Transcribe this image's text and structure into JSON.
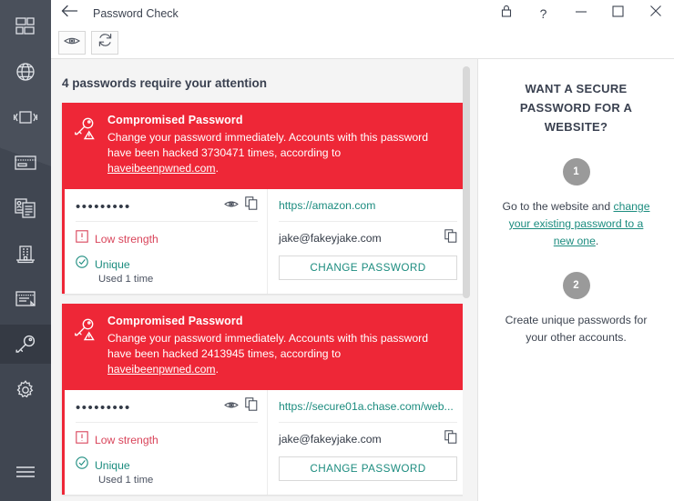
{
  "window": {
    "title": "Password Check",
    "back_icon": "arrow-left-icon",
    "controls": [
      {
        "name": "lock-icon",
        "glyph": "lock"
      },
      {
        "name": "help-icon",
        "glyph": "?"
      },
      {
        "name": "minimize-icon",
        "glyph": "minimize"
      },
      {
        "name": "maximize-icon",
        "glyph": "maximize"
      },
      {
        "name": "close-icon",
        "glyph": "close"
      }
    ]
  },
  "sidebar": {
    "items": [
      {
        "name": "sidebar-item-dashboard",
        "icon": "grid-dashboard-icon",
        "selected": false
      },
      {
        "name": "sidebar-item-websites",
        "icon": "globe-icon",
        "selected": false
      },
      {
        "name": "sidebar-item-devices",
        "icon": "device-icon",
        "selected": false
      },
      {
        "name": "sidebar-item-payments",
        "icon": "credit-card-icon",
        "selected": false
      },
      {
        "name": "sidebar-item-ids",
        "icon": "id-document-icon",
        "selected": false
      },
      {
        "name": "sidebar-item-banking",
        "icon": "bank-building-icon",
        "selected": false
      },
      {
        "name": "sidebar-item-notes",
        "icon": "secure-note-icon",
        "selected": false
      },
      {
        "name": "sidebar-item-password-check",
        "icon": "key-icon",
        "selected": true
      },
      {
        "name": "sidebar-item-settings",
        "icon": "gear-icon",
        "selected": false
      }
    ],
    "menu_icon": "hamburger-menu-icon"
  },
  "toolbar": {
    "buttons": [
      {
        "name": "toggle-visibility-button",
        "icon": "eye-icon"
      },
      {
        "name": "refresh-button",
        "icon": "refresh-icon"
      }
    ]
  },
  "main": {
    "heading": "4 passwords require your attention",
    "cards": [
      {
        "banner_icon": "key-warning-icon",
        "banner_title": "Compromised Password",
        "banner_desc_before": "Change your password immediately. Accounts with this password have been hacked 3730471 times, according to ",
        "banner_link": "haveibeenpwned.com",
        "banner_desc_after": ".",
        "password_masked": "•••••••••",
        "reveal_icon": "eye-icon",
        "copy_password_icon": "copy-icon",
        "strength_label": "Low strength",
        "strength_icon": "alert-box-icon",
        "unique_label": "Unique",
        "unique_icon": "check-circle-icon",
        "usage_label": "Used 1 time",
        "url": "https://amazon.com",
        "username": "jake@fakeyjake.com",
        "copy_username_icon": "copy-icon",
        "change_button": "CHANGE PASSWORD"
      },
      {
        "banner_icon": "key-warning-icon",
        "banner_title": "Compromised Password",
        "banner_desc_before": "Change your password immediately. Accounts with this password have been hacked 2413945 times, according to ",
        "banner_link": "haveibeenpwned.com",
        "banner_desc_after": ".",
        "password_masked": "•••••••••",
        "reveal_icon": "eye-icon",
        "copy_password_icon": "copy-icon",
        "strength_label": "Low strength",
        "strength_icon": "alert-box-icon",
        "unique_label": "Unique",
        "unique_icon": "check-circle-icon",
        "usage_label": "Used 1 time",
        "url": "https://secure01a.chase.com/web...",
        "username": "jake@fakeyjake.com",
        "copy_username_icon": "copy-icon",
        "change_button": "CHANGE PASSWORD"
      }
    ]
  },
  "tips": {
    "title": "WANT A SECURE PASSWORD FOR A WEBSITE?",
    "steps": [
      {
        "number": "1",
        "text_before": "Go to the website and ",
        "link": "change your existing password to a new one",
        "text_after": "."
      },
      {
        "number": "2",
        "text_before": "Create unique passwords for your other accounts.",
        "link": "",
        "text_after": ""
      }
    ]
  },
  "colors": {
    "danger_red": "#ee2737",
    "teal": "#1c8c7f",
    "sidebar": "#434a55",
    "strength_red": "#d9445a"
  }
}
